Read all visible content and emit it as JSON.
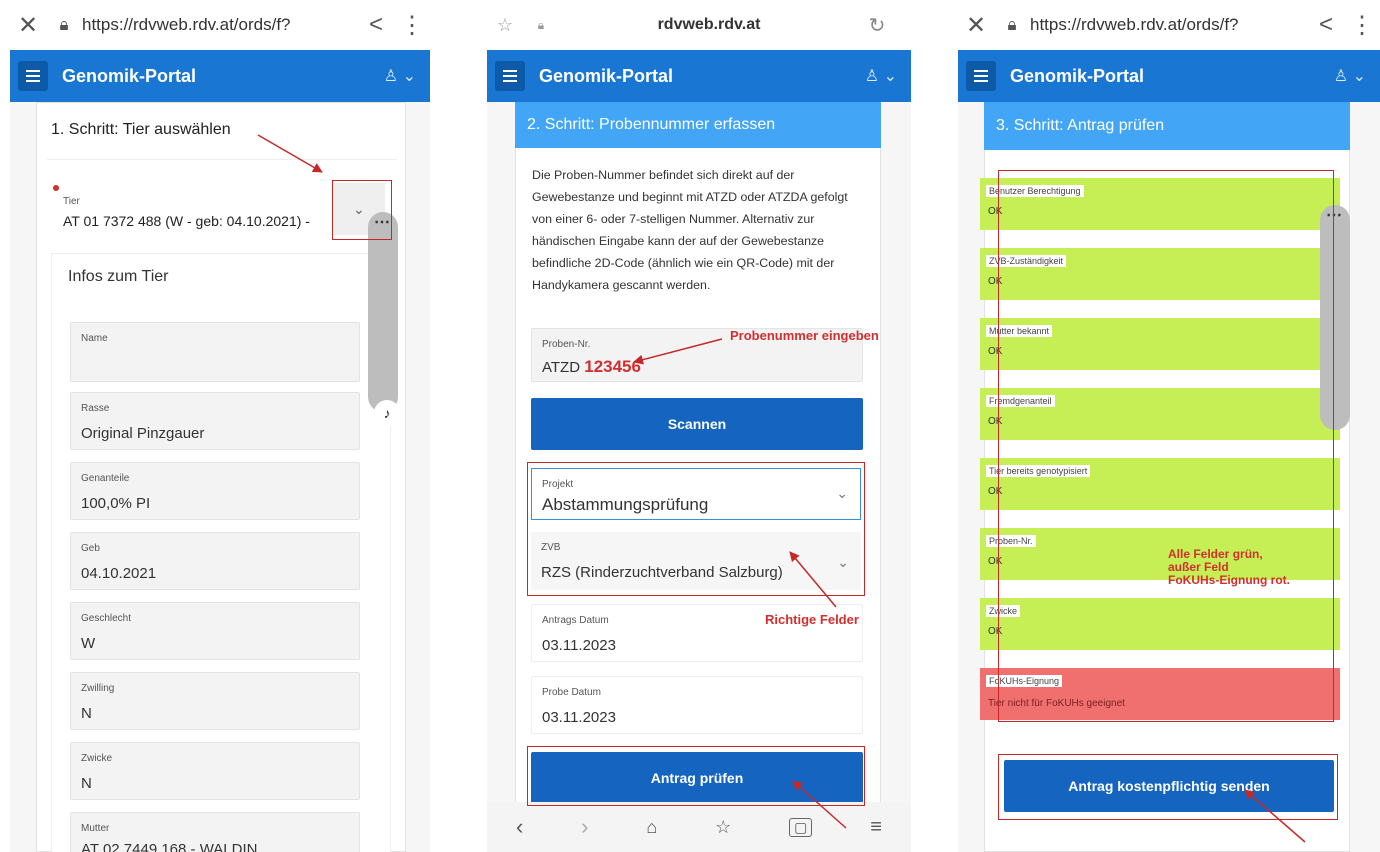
{
  "browser": {
    "url_full": "https://rdvweb.rdv.at/ords/f?",
    "url_short": "rdvweb.rdv.at"
  },
  "app": {
    "title": "Genomik-Portal"
  },
  "step1": {
    "title": "1. Schritt: Tier auswählen",
    "tier_label": "Tier",
    "tier_value": "AT 01 7372 488 (W - geb: 04.10.2021) -",
    "infos_title": "Infos zum Tier",
    "fields": [
      {
        "label": "Name",
        "value": ""
      },
      {
        "label": "Rasse",
        "value": "Original Pinzgauer"
      },
      {
        "label": "Genanteile",
        "value": "100,0% PI"
      },
      {
        "label": "Geb",
        "value": "04.10.2021"
      },
      {
        "label": "Geschlecht",
        "value": "W"
      },
      {
        "label": "Zwilling",
        "value": "N"
      },
      {
        "label": "Zwicke",
        "value": "N"
      },
      {
        "label": "Mutter",
        "value": "AT 02 7449 168 - WALDIN"
      }
    ]
  },
  "step2": {
    "title": "2. Schritt: Probennummer erfassen",
    "description": "Die Proben-Nummer befindet sich direkt auf der Gewebestanze und beginnt mit ATZD oder ATZDA gefolgt von einer 6- oder 7-stelligen Nummer. Alternativ zur händischen Eingabe kann der auf der Gewebestanze befindliche 2D-Code (ähnlich wie ein QR-Code) mit der Handykamera gescannt werden.",
    "proben_label": "Proben-Nr.",
    "proben_prefix": "ATZD",
    "proben_number": "123456",
    "scan_button": "Scannen",
    "projekt_label": "Projekt",
    "projekt_value": "Abstammungsprüfung",
    "zvb_label": "ZVB",
    "zvb_value": "RZS (Rinderzuchtverband Salzburg)",
    "antrags_datum_label": "Antrags Datum",
    "antrags_datum_value": "03.11.2023",
    "probe_datum_label": "Probe Datum",
    "probe_datum_value": "03.11.2023",
    "pruefen_button": "Antrag prüfen"
  },
  "step3": {
    "title": "3. Schritt: Antrag prüfen",
    "checks": [
      {
        "label": "Benutzer Berechtigung",
        "value": "OK",
        "status": "green"
      },
      {
        "label": "ZVB-Zuständigkeit",
        "value": "OK",
        "status": "green"
      },
      {
        "label": "Mutter bekannt",
        "value": "OK",
        "status": "green"
      },
      {
        "label": "Fremdgenanteil",
        "value": "OK",
        "status": "green"
      },
      {
        "label": "Tier bereits genotypisiert",
        "value": "OK",
        "status": "green"
      },
      {
        "label": "Proben-Nr.",
        "value": "OK",
        "status": "green"
      },
      {
        "label": "Zwicke",
        "value": "OK",
        "status": "green"
      },
      {
        "label": "FoKUHs-Eignung",
        "value": "Tier nicht für FoKUHs geeignet",
        "status": "red"
      }
    ],
    "send_button": "Antrag kostenpflichtig senden"
  },
  "annotations": {
    "probennummer": "Probenummer eingeben",
    "richtige_felder": "Richtige Felder",
    "alle_felder_1": "Alle Felder grün,",
    "alle_felder_2": "außer Feld",
    "alle_felder_3": "FoKUHs-Eignung rot."
  },
  "colors": {
    "appbar": "#1976d2",
    "step_header": "#42a5f5",
    "button": "#1565c0",
    "check_ok": "#c5ef55",
    "check_fail": "#f07070",
    "annotation": "#d32f2f"
  }
}
